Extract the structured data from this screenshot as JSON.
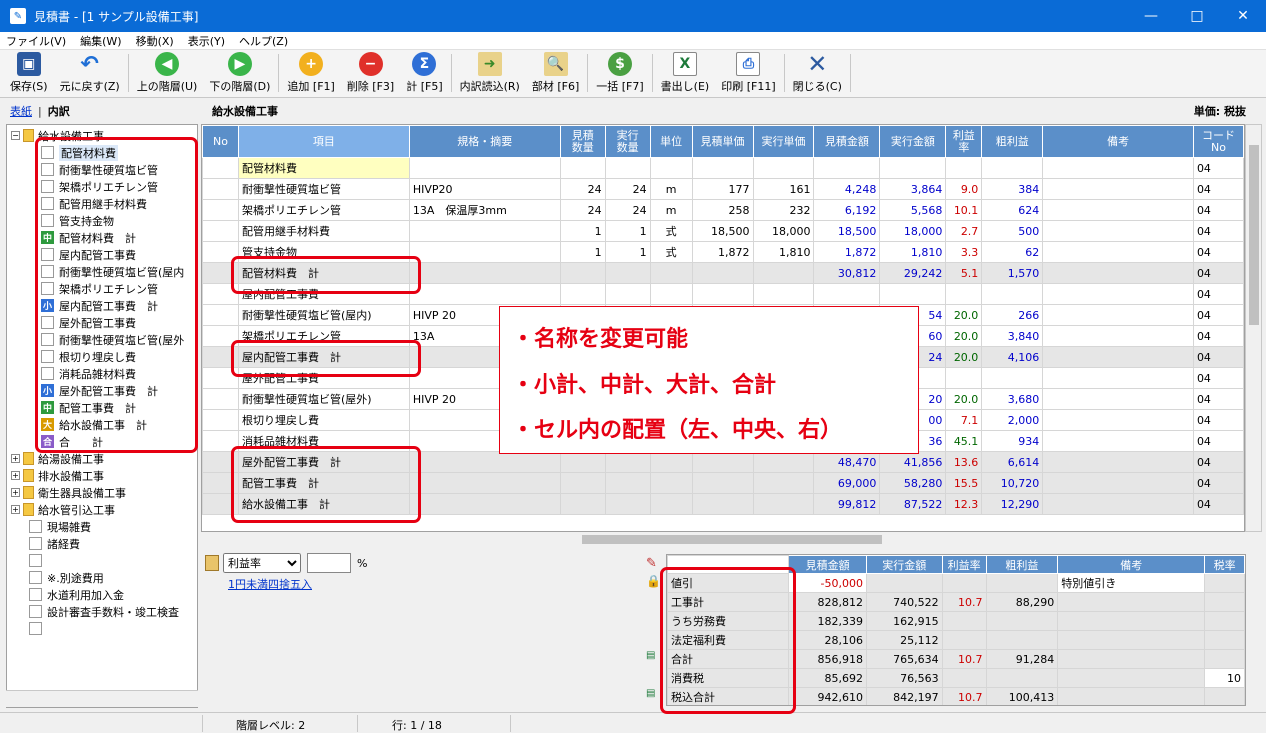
{
  "window": {
    "title": "見積書 - [1 サンプル設備工事]"
  },
  "menu": [
    "ファイル(V)",
    "編集(W)",
    "移動(X)",
    "表示(Y)",
    "ヘルプ(Z)"
  ],
  "toolbar": [
    {
      "label": "保存(S)",
      "icon": "save-icon"
    },
    {
      "label": "元に戻す(Z)",
      "icon": "undo-icon"
    },
    {
      "label": "上の階層(U)",
      "icon": "up-level-icon"
    },
    {
      "label": "下の階層(D)",
      "icon": "down-level-icon"
    },
    {
      "label": "追加 [F1]",
      "icon": "add-icon"
    },
    {
      "label": "削除 [F3]",
      "icon": "delete-icon"
    },
    {
      "label": "計 [F5]",
      "icon": "sum-icon"
    },
    {
      "label": "内訳読込(R)",
      "icon": "import-icon"
    },
    {
      "label": "部材 [F6]",
      "icon": "parts-icon"
    },
    {
      "label": "一括 [F7]",
      "icon": "batch-icon"
    },
    {
      "label": "書出し(E)",
      "icon": "excel-icon"
    },
    {
      "label": "印刷 [F11]",
      "icon": "print-icon"
    },
    {
      "label": "閉じる(C)",
      "icon": "close-icon"
    }
  ],
  "tabs": {
    "cover": "表紙",
    "sep": "|",
    "detail": "内訳"
  },
  "section_title": "給水設備工事",
  "unit_label": "単価: 税抜",
  "tree": [
    {
      "label": "給水設備工事",
      "type": "folder-open",
      "level": 0
    },
    {
      "label": "配管材料費",
      "type": "cb",
      "level": 1,
      "selected": true
    },
    {
      "label": "耐衝撃性硬質塩ビ管",
      "type": "cb",
      "level": 1
    },
    {
      "label": "架橋ポリエチレン管",
      "type": "cb",
      "level": 1
    },
    {
      "label": "配管用継手材料費",
      "type": "cb",
      "level": 1
    },
    {
      "label": "管支持金物",
      "type": "cb",
      "level": 1
    },
    {
      "label": "配管材料費　計",
      "type": "badge",
      "badge": "中",
      "level": 1
    },
    {
      "label": "屋内配管工事費",
      "type": "cb",
      "level": 1
    },
    {
      "label": "耐衝撃性硬質塩ビ管(屋内",
      "type": "cb",
      "level": 1
    },
    {
      "label": "架橋ポリエチレン管",
      "type": "cb",
      "level": 1
    },
    {
      "label": "屋内配管工事費　計",
      "type": "badge",
      "badge": "小",
      "level": 1
    },
    {
      "label": "屋外配管工事費",
      "type": "cb",
      "level": 1
    },
    {
      "label": "耐衝撃性硬質塩ビ管(屋外",
      "type": "cb",
      "level": 1
    },
    {
      "label": "根切り埋戻し費",
      "type": "cb",
      "level": 1
    },
    {
      "label": "消耗品雑材料費",
      "type": "cb",
      "level": 1
    },
    {
      "label": "屋外配管工事費　計",
      "type": "badge",
      "badge": "小",
      "level": 1
    },
    {
      "label": "配管工事費　計",
      "type": "badge",
      "badge": "中",
      "level": 1
    },
    {
      "label": "給水設備工事　計",
      "type": "badge",
      "badge": "大",
      "level": 1
    },
    {
      "label": "合　　計",
      "type": "badge",
      "badge": "合",
      "level": 1
    },
    {
      "label": "給湯設備工事",
      "type": "folder",
      "level": 0
    },
    {
      "label": "排水設備工事",
      "type": "folder",
      "level": 0
    },
    {
      "label": "衛生器具設備工事",
      "type": "folder",
      "level": 0
    },
    {
      "label": "給水管引込工事",
      "type": "folder",
      "level": 0
    },
    {
      "label": "現場雑費",
      "type": "cb",
      "level": 0
    },
    {
      "label": "諸経費",
      "type": "cb",
      "level": 0
    },
    {
      "label": "",
      "type": "cb",
      "level": 0
    },
    {
      "label": "※.別途費用",
      "type": "cb",
      "level": 0
    },
    {
      "label": "水道利用加入金",
      "type": "cb",
      "level": 0
    },
    {
      "label": "設計審査手数料・竣工検査",
      "type": "cb",
      "level": 0
    },
    {
      "label": "",
      "type": "cb",
      "level": 0
    }
  ],
  "grid": {
    "headers": [
      "No",
      "項目",
      "規格・摘要",
      "見積\n数量",
      "実行\n数量",
      "単位",
      "見積単価",
      "実行単価",
      "見積金額",
      "実行金額",
      "利益\n率",
      "粗利益",
      "備考",
      "コード\nNo"
    ],
    "rows": [
      {
        "no": "",
        "item": "配管材料費",
        "spec": "",
        "qe": "",
        "qa": "",
        "unit": "",
        "pe": "",
        "pa": "",
        "ae": "",
        "aa": "",
        "rate": "",
        "profit": "",
        "note": "",
        "code": "04",
        "hl": true
      },
      {
        "no": "",
        "item": "耐衝撃性硬質塩ビ管",
        "spec": "HIVP20",
        "qe": "24",
        "qa": "24",
        "unit": "m",
        "pe": "177",
        "pa": "161",
        "ae": "4,248",
        "aa": "3,864",
        "rate": "9.0",
        "profit": "384",
        "note": "",
        "code": "04"
      },
      {
        "no": "",
        "item": "架橋ポリエチレン管",
        "spec": "13A　保温厚3mm",
        "qe": "24",
        "qa": "24",
        "unit": "m",
        "pe": "258",
        "pa": "232",
        "ae": "6,192",
        "aa": "5,568",
        "rate": "10.1",
        "profit": "624",
        "note": "",
        "code": "04"
      },
      {
        "no": "",
        "item": "配管用継手材料費",
        "spec": "",
        "qe": "1",
        "qa": "1",
        "unit": "式",
        "pe": "18,500",
        "pa": "18,000",
        "ae": "18,500",
        "aa": "18,000",
        "rate": "2.7",
        "profit": "500",
        "note": "",
        "code": "04"
      },
      {
        "no": "",
        "item": "管支持金物",
        "spec": "",
        "qe": "1",
        "qa": "1",
        "unit": "式",
        "pe": "1,872",
        "pa": "1,810",
        "ae": "1,872",
        "aa": "1,810",
        "rate": "3.3",
        "profit": "62",
        "note": "",
        "code": "04"
      },
      {
        "no": "",
        "item": "配管材料費　計",
        "spec": "",
        "qe": "",
        "qa": "",
        "unit": "",
        "pe": "",
        "pa": "",
        "ae": "30,812",
        "aa": "29,242",
        "rate": "5.1",
        "profit": "1,570",
        "note": "",
        "code": "04",
        "sub": true
      },
      {
        "no": "",
        "item": "屋内配管工事費",
        "spec": "",
        "qe": "",
        "qa": "",
        "unit": "",
        "pe": "",
        "pa": "",
        "ae": "",
        "aa": "",
        "rate": "",
        "profit": "",
        "note": "",
        "code": "04"
      },
      {
        "no": "",
        "item": "耐衝撃性硬質塩ビ管(屋内)",
        "spec": "HIVP 20",
        "qe": "",
        "qa": "",
        "unit": "",
        "pe": "",
        "pa": "",
        "ae": "",
        "aa": "54",
        "rate": "20.0",
        "profit": "266",
        "note": "",
        "code": "04"
      },
      {
        "no": "",
        "item": "架橋ポリエチレン管",
        "spec": "13A",
        "qe": "",
        "qa": "",
        "unit": "",
        "pe": "",
        "pa": "",
        "ae": "",
        "aa": "60",
        "rate": "20.0",
        "profit": "3,840",
        "note": "",
        "code": "04"
      },
      {
        "no": "",
        "item": "屋内配管工事費　計",
        "spec": "",
        "qe": "",
        "qa": "",
        "unit": "",
        "pe": "",
        "pa": "",
        "ae": "",
        "aa": "24",
        "rate": "20.0",
        "profit": "4,106",
        "note": "",
        "code": "04",
        "sub": true
      },
      {
        "no": "",
        "item": "屋外配管工事費",
        "spec": "",
        "qe": "",
        "qa": "",
        "unit": "",
        "pe": "",
        "pa": "",
        "ae": "",
        "aa": "",
        "rate": "",
        "profit": "",
        "note": "",
        "code": "04"
      },
      {
        "no": "",
        "item": "耐衝撃性硬質塩ビ管(屋外)",
        "spec": "HIVP 20",
        "qe": "",
        "qa": "",
        "unit": "",
        "pe": "",
        "pa": "",
        "ae": "",
        "aa": "20",
        "rate": "20.0",
        "profit": "3,680",
        "note": "",
        "code": "04"
      },
      {
        "no": "",
        "item": "根切り埋戻し費",
        "spec": "",
        "qe": "",
        "qa": "",
        "unit": "",
        "pe": "",
        "pa": "",
        "ae": "",
        "aa": "00",
        "rate": "7.1",
        "profit": "2,000",
        "note": "",
        "code": "04"
      },
      {
        "no": "",
        "item": "消耗品雑材料費",
        "spec": "",
        "qe": "",
        "qa": "",
        "unit": "",
        "pe": "",
        "pa": "",
        "ae": "",
        "aa": "36",
        "rate": "45.1",
        "profit": "934",
        "note": "",
        "code": "04"
      },
      {
        "no": "",
        "item": "屋外配管工事費　計",
        "spec": "",
        "qe": "",
        "qa": "",
        "unit": "",
        "pe": "",
        "pa": "",
        "ae": "48,470",
        "aa": "41,856",
        "rate": "13.6",
        "profit": "6,614",
        "note": "",
        "code": "04",
        "sub": true
      },
      {
        "no": "",
        "item": "配管工事費　計",
        "spec": "",
        "qe": "",
        "qa": "",
        "unit": "",
        "pe": "",
        "pa": "",
        "ae": "69,000",
        "aa": "58,280",
        "rate": "15.5",
        "profit": "10,720",
        "note": "",
        "code": "04",
        "sub": true
      },
      {
        "no": "",
        "item": "給水設備工事　計",
        "spec": "",
        "qe": "",
        "qa": "",
        "unit": "",
        "pe": "",
        "pa": "",
        "ae": "99,812",
        "aa": "87,522",
        "rate": "12.3",
        "profit": "12,290",
        "note": "",
        "code": "04",
        "sub": true
      }
    ]
  },
  "rate_control": {
    "select_value": "利益率",
    "input_value": "",
    "percent": "%",
    "rounding_link": "1円未満四捨五入"
  },
  "summary": {
    "headers": [
      "",
      "見積金額",
      "実行金額",
      "利益率",
      "粗利益",
      "備考",
      "税率"
    ],
    "rows": [
      {
        "label": "値引",
        "est": "-50,000",
        "act": "",
        "rate": "",
        "profit": "",
        "note": "特別値引き",
        "tax": ""
      },
      {
        "label": "工事計",
        "est": "828,812",
        "act": "740,522",
        "rate": "10.7",
        "profit": "88,290",
        "note": "",
        "tax": ""
      },
      {
        "label": "うち労務費",
        "est": "182,339",
        "act": "162,915",
        "rate": "",
        "profit": "",
        "note": "",
        "tax": ""
      },
      {
        "label": "法定福利費",
        "est": "28,106",
        "act": "25,112",
        "rate": "",
        "profit": "",
        "note": "",
        "tax": ""
      },
      {
        "label": "合計",
        "est": "856,918",
        "act": "765,634",
        "rate": "10.7",
        "profit": "91,284",
        "note": "",
        "tax": ""
      },
      {
        "label": "消費税",
        "est": "85,692",
        "act": "76,563",
        "rate": "",
        "profit": "",
        "note": "",
        "tax": "10"
      },
      {
        "label": "税込合計",
        "est": "942,610",
        "act": "842,197",
        "rate": "10.7",
        "profit": "100,413",
        "note": "",
        "tax": ""
      }
    ]
  },
  "status": {
    "level": "階層レベル: 2",
    "row": "行: 1 / 18"
  },
  "callout": [
    "・名称を変更可能",
    "・小計、中計、大計、合計",
    "・セル内の配置（左、中央、右）"
  ],
  "colors": {
    "title_bar": "#0a6bd6",
    "grid_header": "#5b8fc9",
    "annotation_red": "#e60012",
    "amount_blue": "#0000cc",
    "rate_red": "#cc0000",
    "rate_green": "#006600"
  }
}
